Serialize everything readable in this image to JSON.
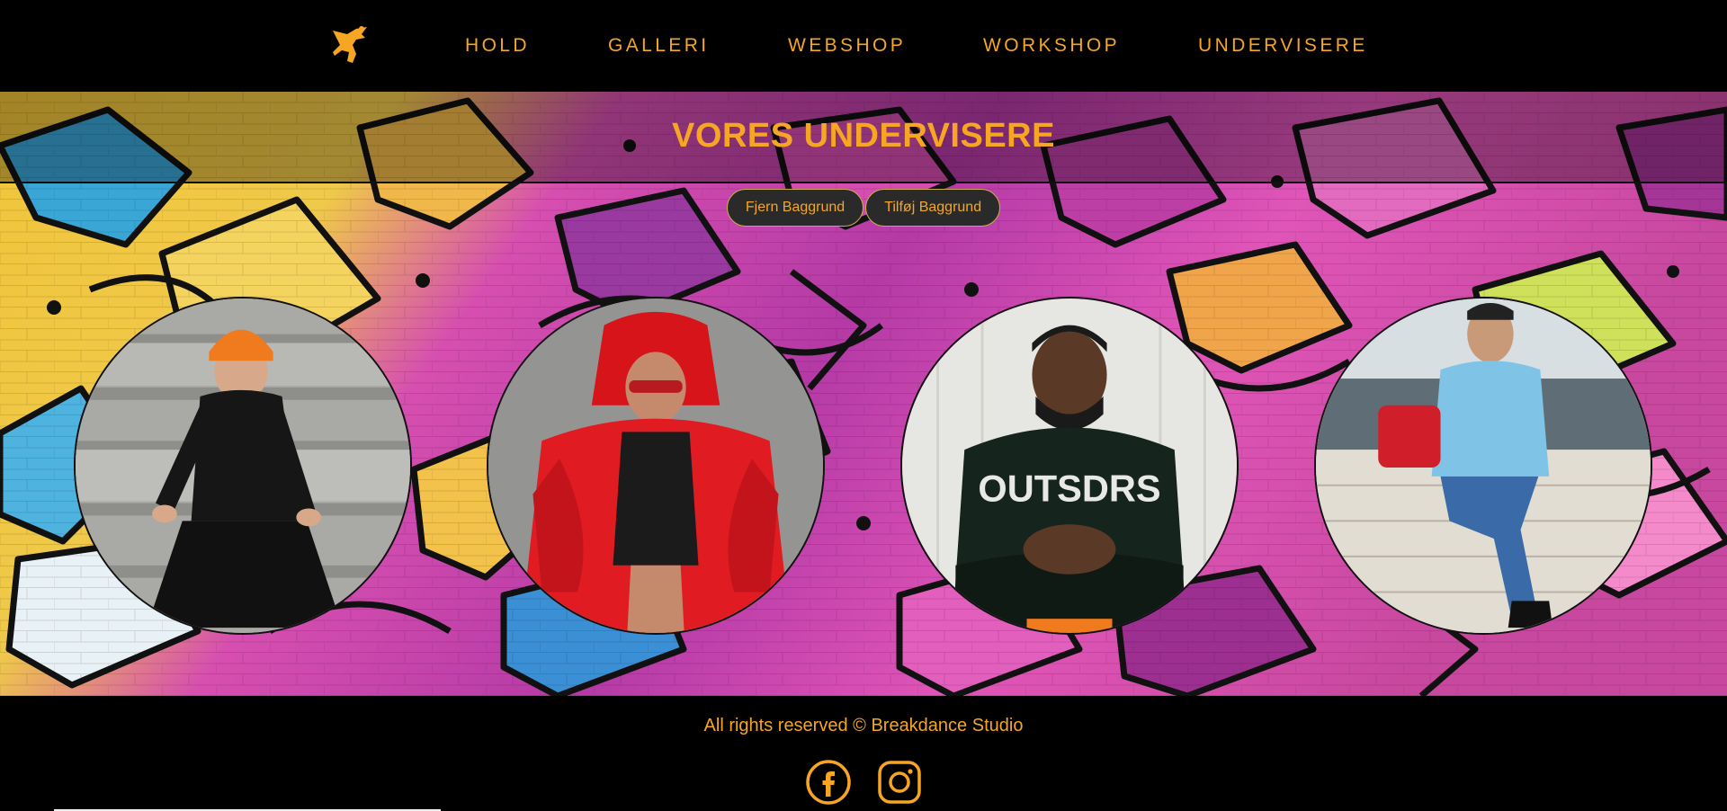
{
  "nav": {
    "logo_icon": "dancer-logo-icon",
    "links": [
      {
        "label": "HOLD"
      },
      {
        "label": "GALLERI"
      },
      {
        "label": "WEBSHOP"
      },
      {
        "label": "WORKSHOP"
      },
      {
        "label": "UNDERVISERE"
      }
    ]
  },
  "hero": {
    "title": "VORES UNDERVISERE",
    "buttons": {
      "remove_bg": "Fjern Baggrund",
      "add_bg": "Tilføj Baggrund"
    }
  },
  "teachers": [
    {
      "photo": "teacher-photo-1"
    },
    {
      "photo": "teacher-photo-2"
    },
    {
      "photo": "teacher-photo-3"
    },
    {
      "photo": "teacher-photo-4"
    }
  ],
  "footer": {
    "copyright": "All rights reserved © Breakdance Studio",
    "social": [
      "facebook-icon",
      "instagram-icon"
    ]
  },
  "colors": {
    "accent": "#f6a623",
    "background": "#000000",
    "pill_bg": "#2a2a2a"
  }
}
